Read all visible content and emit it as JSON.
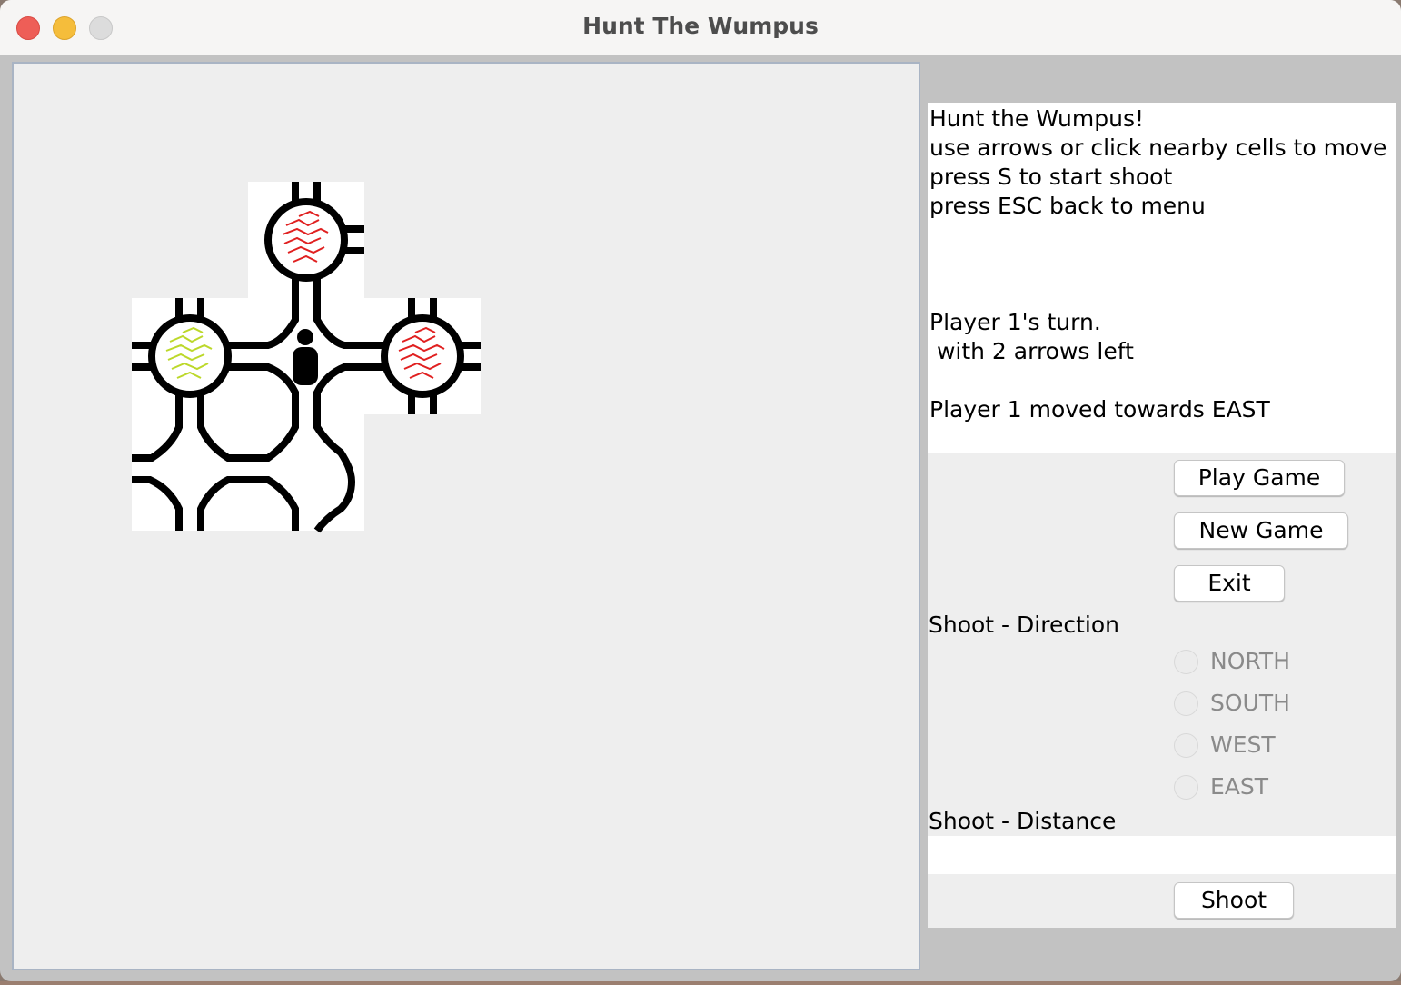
{
  "window": {
    "title": "Hunt The Wumpus"
  },
  "info": {
    "line1": "Hunt the Wumpus!",
    "line2": "use arrows or click nearby cells to move",
    "line3": "press S to start shoot",
    "line4": "press ESC back to menu",
    "turn": "Player 1's turn.",
    "arrows": " with 2 arrows left",
    "last_move": "Player 1 moved towards EAST"
  },
  "buttons": {
    "play": "Play Game",
    "new": "New Game",
    "exit": "Exit",
    "shoot": "Shoot"
  },
  "shoot_direction": {
    "label": "Shoot - Direction",
    "options": [
      "NORTH",
      "SOUTH",
      "WEST",
      "EAST"
    ]
  },
  "shoot_distance": {
    "label": "Shoot - Distance",
    "value": ""
  },
  "colors": {
    "pit": "#e02020",
    "slime": "#bcd82a",
    "tunnel": "#000000",
    "board_bg": "#eeeeee"
  },
  "icons": {
    "player": "player-figure-icon"
  }
}
